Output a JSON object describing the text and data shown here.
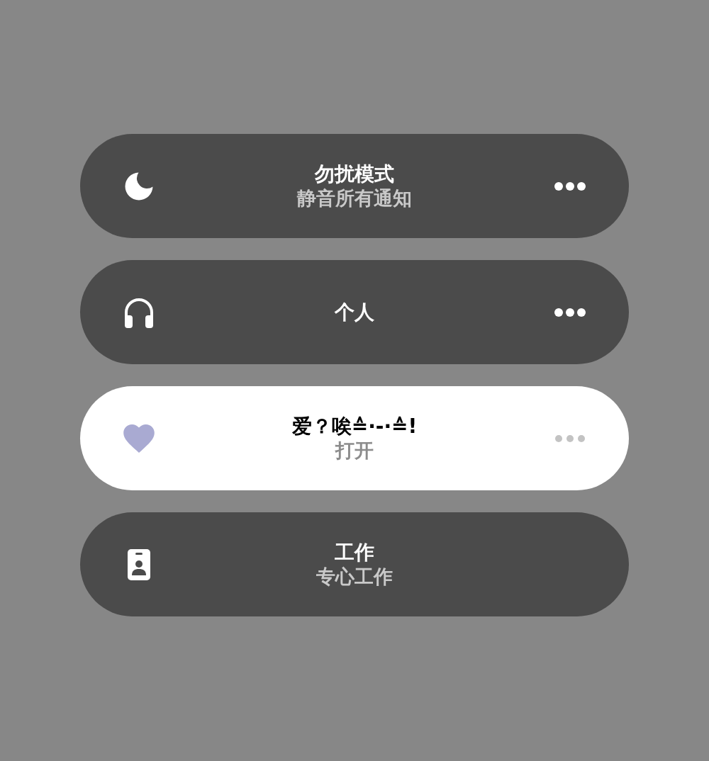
{
  "focus_modes": [
    {
      "kind": "moon",
      "title": "勿扰模式",
      "subtitle": "静音所有通知",
      "selected": false,
      "more_button": true
    },
    {
      "kind": "headphones",
      "title": "个人",
      "selected": false,
      "more_button": true
    },
    {
      "kind": "heart",
      "title": "爱？唉≙·-·≙!",
      "subtitle": "打开",
      "selected": true,
      "more_button": true,
      "color": "#a9aad2"
    },
    {
      "kind": "badge",
      "title": "工作",
      "subtitle": "专心工作",
      "selected": false,
      "more_button": false
    }
  ]
}
